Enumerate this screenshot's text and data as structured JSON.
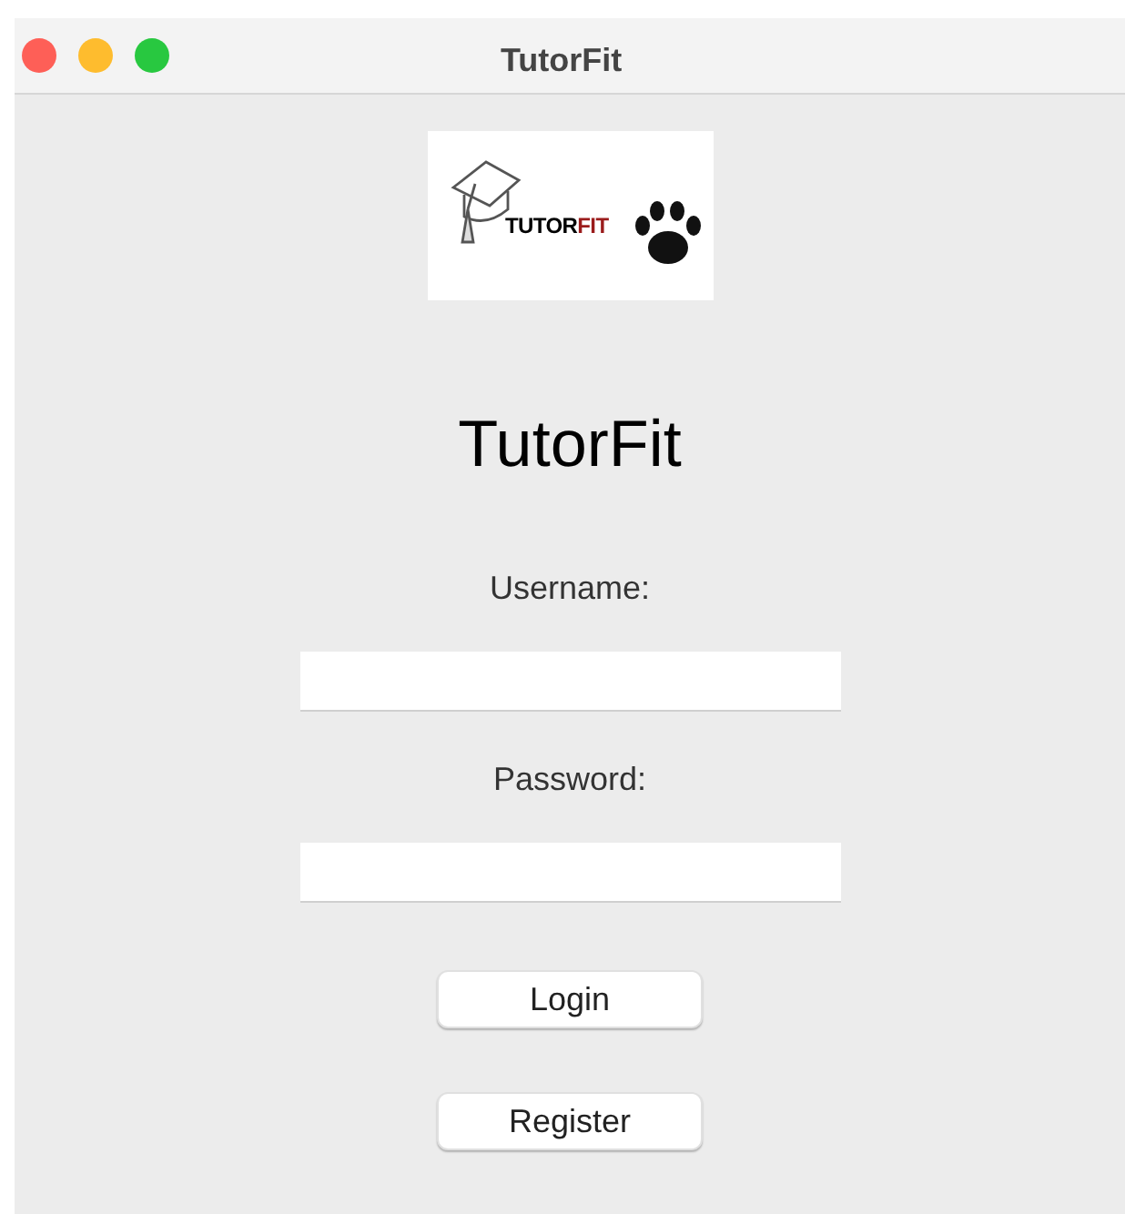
{
  "window": {
    "title": "TutorFit"
  },
  "logo": {
    "text_main": "TUTOR",
    "text_accent": "FIT"
  },
  "heading": "TutorFit",
  "fields": [
    {
      "label": "Username:"
    },
    {
      "label": "Password:"
    }
  ],
  "buttons": [
    "Login",
    "Register"
  ]
}
